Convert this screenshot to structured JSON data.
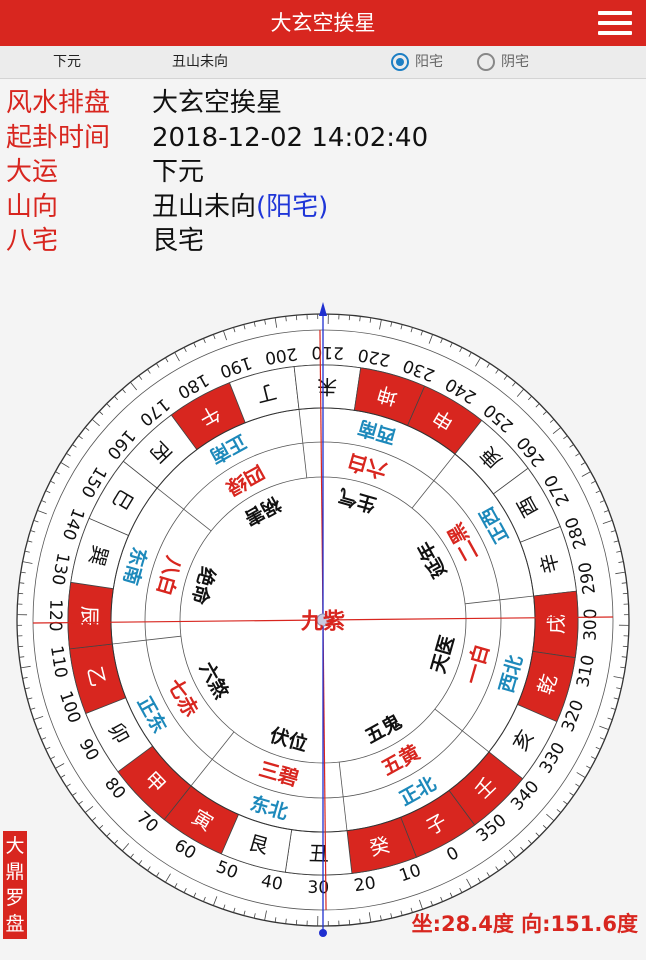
{
  "header": {
    "title": "大玄空挨星"
  },
  "subbar": {
    "yun": "下元",
    "shan": "丑山未向",
    "options": [
      {
        "label": "阳宅",
        "selected": true
      },
      {
        "label": "阴宅",
        "selected": false
      }
    ]
  },
  "info": {
    "rows": [
      {
        "key": "风水排盘",
        "value": "大玄空挨星"
      },
      {
        "key": "起卦时间",
        "value": "2018-12-02 14:02:40"
      },
      {
        "key": "大运",
        "value": "下元"
      },
      {
        "key": "山向",
        "value": "丑山未向",
        "paren": "(阳宅)"
      },
      {
        "key": "八宅",
        "value": "艮宅"
      }
    ]
  },
  "compass": {
    "degree_labels": [
      "0",
      "10",
      "20",
      "30",
      "40",
      "50",
      "60",
      "70",
      "80",
      "90",
      "100",
      "110",
      "120",
      "130",
      "140",
      "150",
      "160",
      "170",
      "180",
      "190",
      "200",
      "210",
      "220",
      "230",
      "240",
      "250",
      "260",
      "270",
      "280",
      "290",
      "300",
      "310",
      "320",
      "330",
      "340",
      "350"
    ],
    "mountains": [
      {
        "name": "子",
        "red": true
      },
      {
        "name": "癸",
        "red": true
      },
      {
        "name": "丑",
        "red": false
      },
      {
        "name": "艮",
        "red": false
      },
      {
        "name": "寅",
        "red": true
      },
      {
        "name": "甲",
        "red": true
      },
      {
        "name": "卯",
        "red": false
      },
      {
        "name": "乙",
        "red": true
      },
      {
        "name": "辰",
        "red": true
      },
      {
        "name": "巽",
        "red": false
      },
      {
        "name": "巳",
        "red": false
      },
      {
        "name": "丙",
        "red": false
      },
      {
        "name": "午",
        "red": true
      },
      {
        "name": "丁",
        "red": false
      },
      {
        "name": "未",
        "red": false
      },
      {
        "name": "坤",
        "red": true
      },
      {
        "name": "申",
        "red": true
      },
      {
        "name": "庚",
        "red": false
      },
      {
        "name": "酉",
        "red": false
      },
      {
        "name": "辛",
        "red": false
      },
      {
        "name": "戌",
        "red": true
      },
      {
        "name": "乾",
        "red": true
      },
      {
        "name": "亥",
        "red": false
      },
      {
        "name": "壬",
        "red": true
      }
    ],
    "palaces": [
      {
        "dir": "正北",
        "star": "五黄",
        "life": "五鬼"
      },
      {
        "dir": "东北",
        "star": "三碧",
        "life": "伏位"
      },
      {
        "dir": "正东",
        "star": "七赤",
        "life": "六煞"
      },
      {
        "dir": "东南",
        "star": "八白",
        "life": "绝命"
      },
      {
        "dir": "正南",
        "star": "四绿",
        "life": "祸害"
      },
      {
        "dir": "西南",
        "star": "六白",
        "life": "生气"
      },
      {
        "dir": "正西",
        "star": "二黑",
        "life": "延年"
      },
      {
        "dir": "西北",
        "star": "一白",
        "life": "天医"
      }
    ],
    "center": "九紫",
    "colors": {
      "red": "#d8261f",
      "blue": "#1d89bb",
      "needle": "#1f2fd0"
    }
  },
  "brand": [
    "大",
    "鼎",
    "罗",
    "盘"
  ],
  "footer": "坐:28.4度 向:151.6度"
}
